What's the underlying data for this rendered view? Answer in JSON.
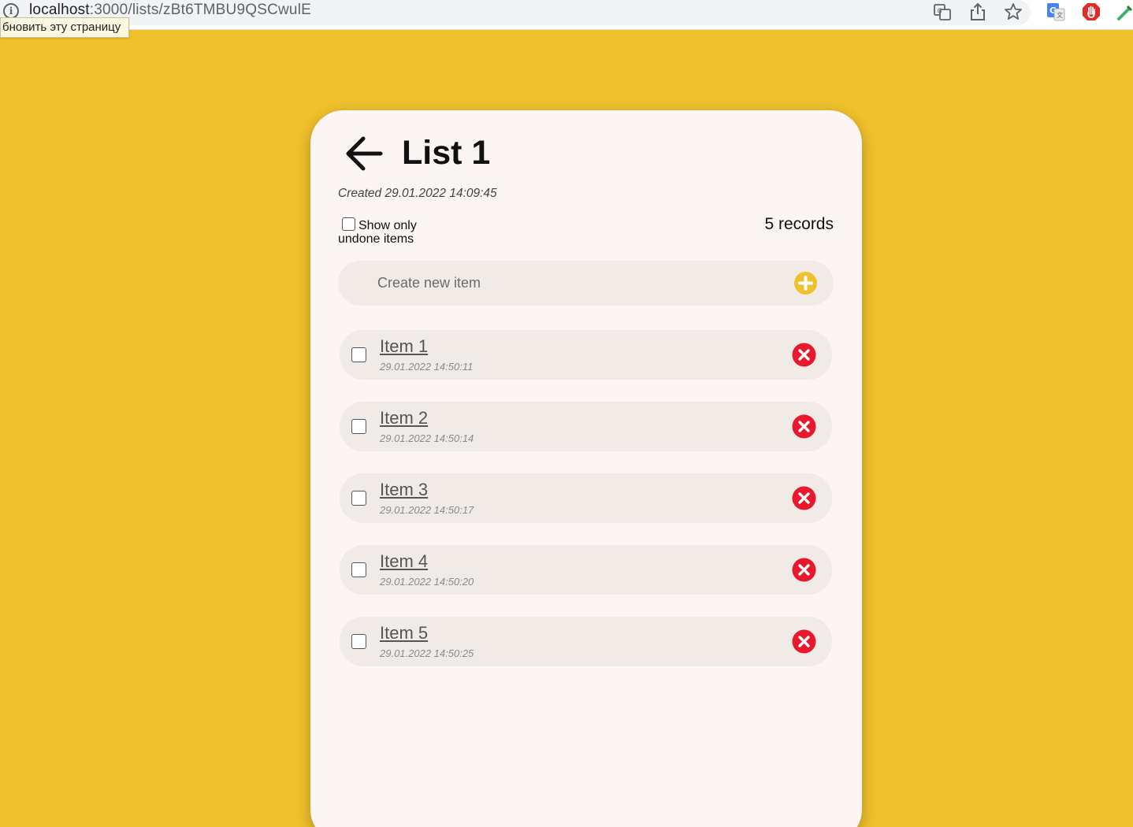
{
  "browser": {
    "url_host": "localhost",
    "url_path": ":3000/lists/zBt6TMBU9QSCwulE",
    "tooltip": "бновить эту страницу"
  },
  "list": {
    "title": "List 1",
    "created": "Created 29.01.2022 14:09:45",
    "filter_label": "Show only undone items",
    "records": "5 records",
    "new_item_placeholder": "Create new item"
  },
  "items": [
    {
      "name": "Item 1",
      "date": "29.01.2022 14:50:11",
      "done": false
    },
    {
      "name": "Item 2",
      "date": "29.01.2022 14:50:14",
      "done": false
    },
    {
      "name": "Item 3",
      "date": "29.01.2022 14:50:17",
      "done": false
    },
    {
      "name": "Item 4",
      "date": "29.01.2022 14:50:20",
      "done": false
    },
    {
      "name": "Item 5",
      "date": "29.01.2022 14:50:25",
      "done": false
    }
  ],
  "colors": {
    "page_background": "#f0c12c",
    "card_background": "#fbf5f4",
    "add_button": "#f0c12c",
    "delete_button": "#e8192c"
  },
  "icons": {
    "back": "arrow-left-icon",
    "add": "plus-circle-icon",
    "delete": "x-circle-icon"
  }
}
